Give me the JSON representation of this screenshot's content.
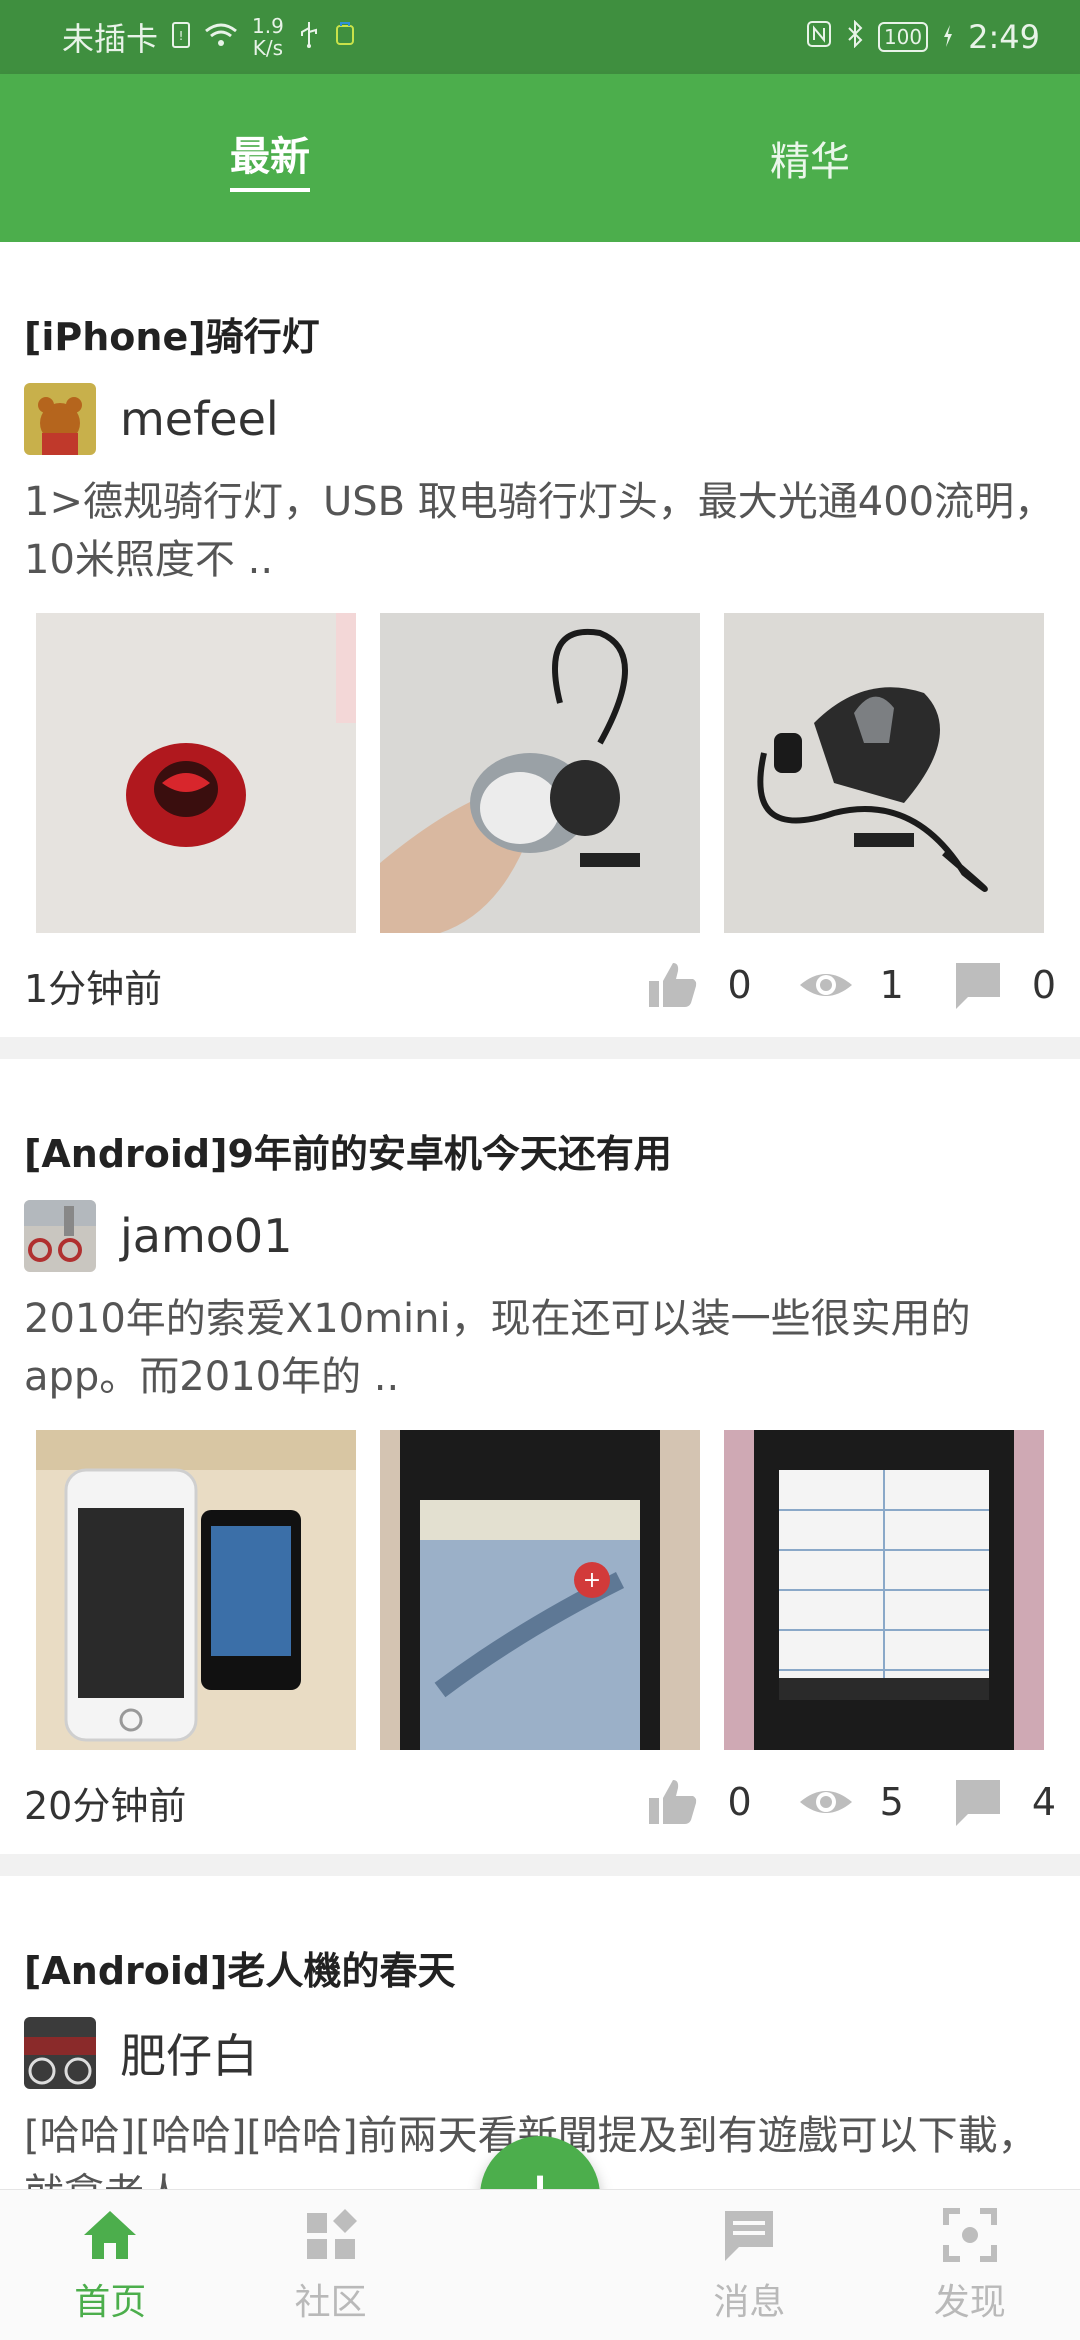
{
  "status_bar": {
    "carrier": "未插卡",
    "speed_value": "1.9",
    "speed_unit": "K/s",
    "battery": "100",
    "time": "2:49"
  },
  "tabs": [
    {
      "label": "最新",
      "active": true
    },
    {
      "label": "精华",
      "active": false
    }
  ],
  "posts": [
    {
      "title": "[iPhone]骑行灯",
      "author": "mefeel",
      "excerpt": "1>德规骑行灯，USB 取电骑行灯头，最大光通400流明，10米照度不 ..",
      "time": "1分钟前",
      "likes": "0",
      "views": "1",
      "comments": "0"
    },
    {
      "title": "[Android]9年前的安卓机今天还有用",
      "author": "jamo01",
      "excerpt": "2010年的索爱X10mini，现在还可以装一些很实用的app。而2010年的 ..",
      "time": "20分钟前",
      "likes": "0",
      "views": "5",
      "comments": "4"
    },
    {
      "title": "[Android]老人機的春天",
      "author": "肥仔白",
      "excerpt": "[哈哈][哈哈][哈哈]前兩天看新聞提及到有遊戲可以下載，就拿老人 .."
    }
  ],
  "bottom_nav": {
    "home": "首页",
    "community": "社区",
    "messages": "消息",
    "discover": "发现",
    "fab": "+"
  },
  "colors": {
    "primary": "#4cae4c",
    "status_bar": "#3f8f3f",
    "inactive": "#b9b9b9"
  }
}
